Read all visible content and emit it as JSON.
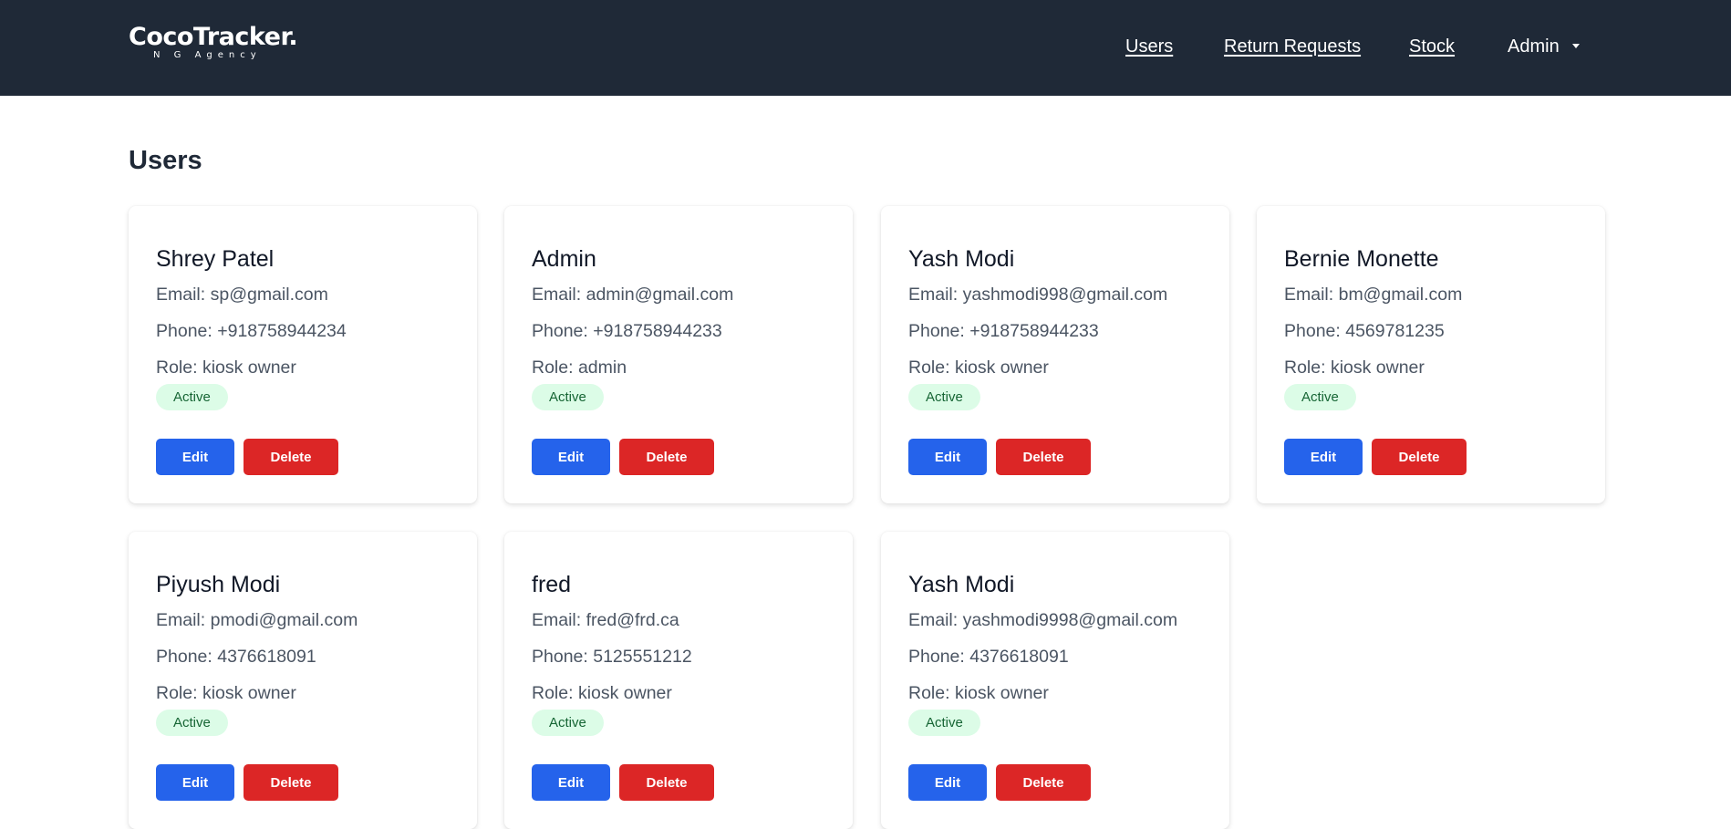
{
  "brand": {
    "name": "CocoTracker.",
    "tagline": "N G Agency"
  },
  "nav": {
    "users": "Users",
    "return_requests": "Return Requests",
    "stock": "Stock",
    "admin": "Admin"
  },
  "page": {
    "title": "Users"
  },
  "users": [
    {
      "name": "Shrey Patel",
      "email": "Email: sp@gmail.com",
      "phone": "Phone: +918758944234",
      "role": "Role: kiosk owner",
      "status": "Active",
      "edit": "Edit",
      "delete": "Delete"
    },
    {
      "name": "Admin",
      "email": "Email: admin@gmail.com",
      "phone": "Phone: +918758944233",
      "role": "Role: admin",
      "status": "Active",
      "edit": "Edit",
      "delete": "Delete"
    },
    {
      "name": "Yash Modi",
      "email": "Email: yashmodi998@gmail.com",
      "phone": "Phone: +918758944233",
      "role": "Role: kiosk owner",
      "status": "Active",
      "edit": "Edit",
      "delete": "Delete"
    },
    {
      "name": "Bernie Monette",
      "email": "Email: bm@gmail.com",
      "phone": "Phone: 4569781235",
      "role": "Role: kiosk owner",
      "status": "Active",
      "edit": "Edit",
      "delete": "Delete"
    },
    {
      "name": "Piyush Modi",
      "email": "Email: pmodi@gmail.com",
      "phone": "Phone: 4376618091",
      "role": "Role: kiosk owner",
      "status": "Active",
      "edit": "Edit",
      "delete": "Delete"
    },
    {
      "name": "fred",
      "email": "Email: fred@frd.ca",
      "phone": "Phone: 5125551212",
      "role": "Role: kiosk owner",
      "status": "Active",
      "edit": "Edit",
      "delete": "Delete"
    },
    {
      "name": "Yash Modi",
      "email": "Email: yashmodi9998@gmail.com",
      "phone": "Phone: 4376618091",
      "role": "Role: kiosk owner",
      "status": "Active",
      "edit": "Edit",
      "delete": "Delete"
    }
  ]
}
